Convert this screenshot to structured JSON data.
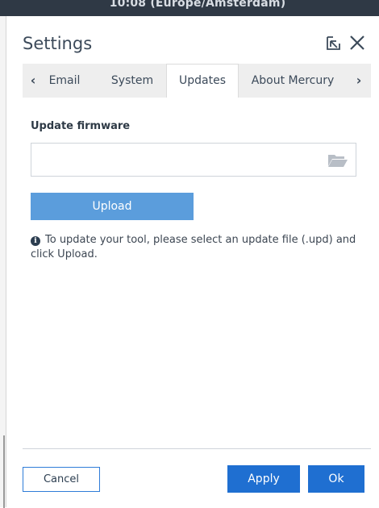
{
  "topbar": {
    "clock": "10:08 (Europe/Amsterdam)"
  },
  "dialog": {
    "title": "Settings",
    "tabs": [
      {
        "label": "Email"
      },
      {
        "label": "System"
      },
      {
        "label": "Updates"
      },
      {
        "label": "About Mercury"
      }
    ],
    "active_tab": "Updates",
    "prev_arrow": "‹",
    "next_arrow": "›"
  },
  "updates": {
    "section_label": "Update firmware",
    "file_value": "",
    "upload_label": "Upload",
    "info_text": "To update your tool, please select an update file (.upd) and click Upload."
  },
  "footer": {
    "cancel_label": "Cancel",
    "apply_label": "Apply",
    "ok_label": "Ok"
  },
  "colors": {
    "primary": "#1f6fd1",
    "upload": "#5b9ddc",
    "text": "#3c4a5a",
    "topbar": "#2f3945"
  },
  "icons": [
    "popout-icon",
    "close-icon",
    "folder-open-icon",
    "info-icon",
    "chevron-left-icon",
    "chevron-right-icon"
  ]
}
